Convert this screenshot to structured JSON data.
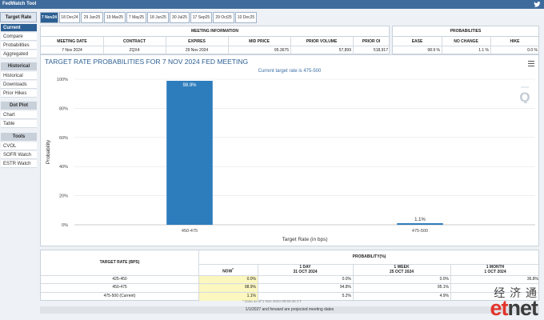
{
  "app": {
    "title": "FedWatch Tool"
  },
  "sidebar": {
    "tab": "Target Rate",
    "items_main": [
      "Current",
      "Compare",
      "Probabilities",
      "Aggregated"
    ],
    "historical_head": "Historical",
    "items_historical": [
      "Historical",
      "Downloads",
      "Prior Hikes"
    ],
    "dotplot_head": "Dot Plot",
    "items_dotplot": [
      "Chart",
      "Table"
    ],
    "tools_head": "Tools",
    "items_tools": [
      "CVOL",
      "SOFR Watch",
      "ESTR Watch"
    ]
  },
  "meeting_tabs": [
    "7 Nov24",
    "18 Dec24",
    "29 Jan25",
    "19 Mar25",
    "7 May25",
    "18 Jun25",
    "30 Jul25",
    "17 Sep25",
    "29 Oct25",
    "10 Dec25"
  ],
  "meeting_info": {
    "title": "MEETING INFORMATION",
    "headers": [
      "MEETING DATE",
      "CONTRACT",
      "EXPIRES",
      "MID PRICE",
      "PRIOR VOLUME",
      "PRIOR OI"
    ],
    "values": [
      "7 Nov 2024",
      "ZQX4",
      "29 Nov 2024",
      "95.3675",
      "57,899",
      "518,917"
    ]
  },
  "probabilities_box": {
    "title": "PROBABILITIES",
    "headers": [
      "EASE",
      "NO CHANGE",
      "HIKE"
    ],
    "values": [
      "98.9 %",
      "1.1 %",
      "0.0 %"
    ]
  },
  "chart": {
    "title": "TARGET RATE PROBABILITIES FOR 7 NOV 2024 FED MEETING",
    "subtitle": "Current target rate is 475-500",
    "colors": {
      "bar": "#2d7dbd",
      "title": "#2c5f93"
    }
  },
  "chart_data": {
    "type": "bar",
    "title": "TARGET RATE PROBABILITIES FOR 7 NOV 2024 FED MEETING",
    "subtitle": "Current target rate is 475-500",
    "categories": [
      "450-475",
      "475-500"
    ],
    "values": [
      98.9,
      1.1
    ],
    "value_labels": [
      "98.9%",
      "1.1%"
    ],
    "xlabel": "Target Rate (in bps)",
    "ylabel": "Probability",
    "ylim": [
      0,
      100
    ],
    "yticks": [
      "0%",
      "20%",
      "40%",
      "60%",
      "80%",
      "100%"
    ],
    "grid": true
  },
  "prob_table": {
    "col_target": "TARGET RATE (BPS)",
    "col_prob": "PROBABILITY(%)",
    "sub_now": "NOW",
    "now_marker": "*",
    "sub_1d": "1 DAY",
    "sub_1d_date": "31 OCT 2024",
    "sub_1w": "1 WEEK",
    "sub_1w_date": "25 OCT 2024",
    "sub_1m": "1 MONTH",
    "sub_1m_date": "1 OCT 2024",
    "rows": [
      {
        "rate": "425-450",
        "now": "0.0%",
        "d1": "0.0%",
        "w1": "0.0%",
        "m1": "36.8%"
      },
      {
        "rate": "450-475",
        "now": "98.9%",
        "d1": "94.8%",
        "w1": "95.1%",
        "m1": ""
      },
      {
        "rate": "475-500 (Current)",
        "now": "1.1%",
        "d1": "5.2%",
        "w1": "4.9%",
        "m1": ""
      }
    ],
    "footnote": "* Data as of 1 Nov 2024 09:50:26 CT",
    "bottom_note": "1/1/2027 and forward are projected meeting dates"
  },
  "watermark": {
    "cn": "经 济 通",
    "en_a": "et",
    "en_b": "net"
  }
}
